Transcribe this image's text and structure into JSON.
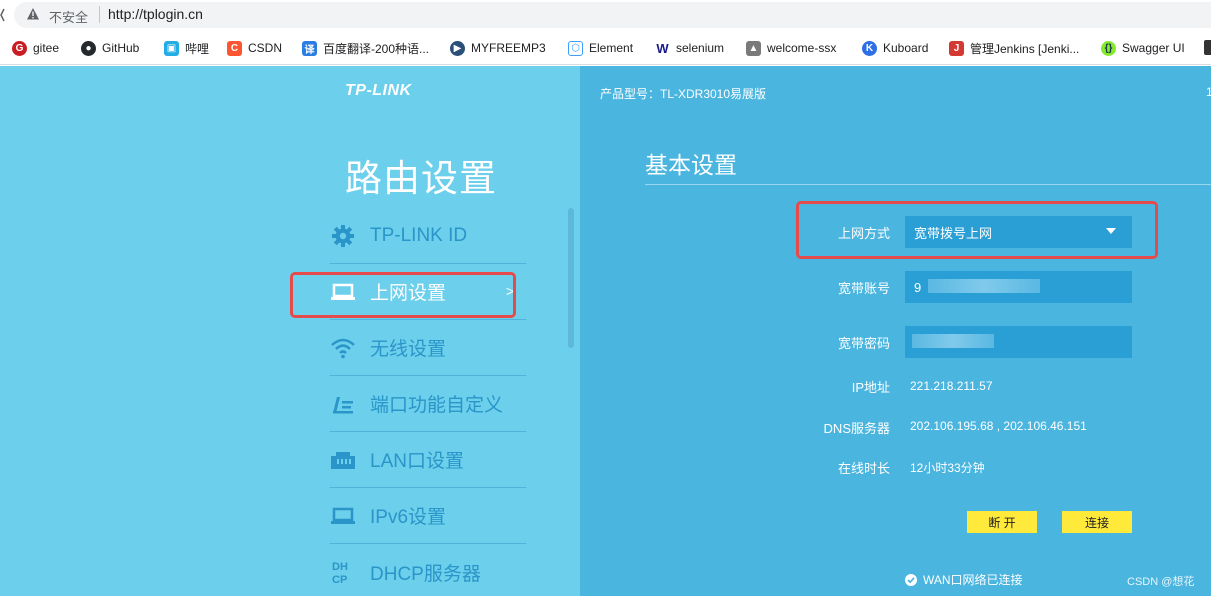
{
  "browser": {
    "security_label": "不安全",
    "url": "http://tplogin.cn"
  },
  "bookmarks": [
    {
      "label": "gitee",
      "icon": "gitee-icon",
      "color": "#c71d23"
    },
    {
      "label": "GitHub",
      "icon": "github-icon",
      "color": "#24292e"
    },
    {
      "label": "哔哩",
      "icon": "bilibili-icon",
      "color": "#23ade5"
    },
    {
      "label": "CSDN",
      "icon": "csdn-icon",
      "color": "#fc5531"
    },
    {
      "label": "百度翻译-200种语...",
      "icon": "baidu-translate-icon",
      "color": "#2a7de1"
    },
    {
      "label": "MYFREEMP3",
      "icon": "myfreemp3-icon",
      "color": "#2a4f78"
    },
    {
      "label": "Element",
      "icon": "element-icon",
      "color": "#409eff"
    },
    {
      "label": "selenium",
      "icon": "selenium-icon",
      "color": "#1a1a8c"
    },
    {
      "label": "welcome-ssx",
      "icon": "welcome-ssx-icon",
      "color": "#7a7a7a"
    },
    {
      "label": "Kuboard",
      "icon": "kuboard-icon",
      "color": "#2f6fe5"
    },
    {
      "label": "管理Jenkins [Jenki...",
      "icon": "jenkins-icon",
      "color": "#d33833"
    },
    {
      "label": "Swagger UI",
      "icon": "swagger-icon",
      "color": "#85ea2d"
    }
  ],
  "router": {
    "brand": "TP-LINK",
    "page_title": "路由设置",
    "model_label": "产品型号：TL-XDR3010易展版",
    "edge_char": "1",
    "menu": [
      {
        "label": "TP-LINK ID",
        "icon": "gear-icon"
      },
      {
        "label": "上网设置",
        "icon": "laptop-icon",
        "active": true
      },
      {
        "label": "无线设置",
        "icon": "wifi-icon"
      },
      {
        "label": "端口功能自定义",
        "icon": "port-custom-icon"
      },
      {
        "label": "LAN口设置",
        "icon": "lan-port-icon"
      },
      {
        "label": "IPv6设置",
        "icon": "laptop-icon"
      },
      {
        "label": "DHCP服务器",
        "icon": "dhcp-icon"
      }
    ],
    "active_arrow": ">",
    "section_title": "基本设置",
    "fields": {
      "connection_type_label": "上网方式",
      "connection_type_value": "宽带拨号上网",
      "account_label": "宽带账号",
      "account_value": "9",
      "password_label": "宽带密码",
      "ip_label": "IP地址",
      "ip_value": "221.218.211.57",
      "dns_label": "DNS服务器",
      "dns_value": "202.106.195.68 , 202.106.46.151",
      "uptime_label": "在线时长",
      "uptime_value": "12小时33分钟"
    },
    "buttons": {
      "disconnect": "断 开",
      "connect": "连接"
    },
    "status_text": "WAN口网络已连接",
    "watermark": "CSDN @想花"
  },
  "colors": {
    "left_bg": "#6ccfec",
    "right_bg": "#4ab5df",
    "highlight_red": "#e64b4b",
    "button_yellow": "#ffe93a"
  }
}
